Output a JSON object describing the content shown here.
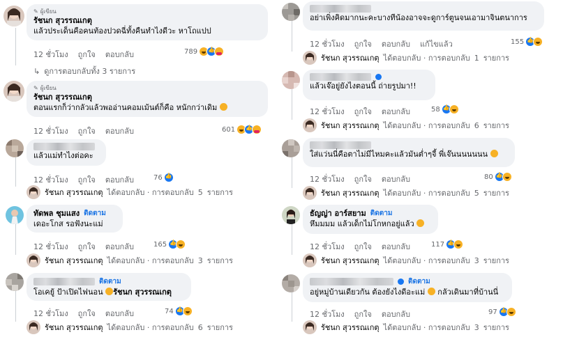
{
  "author_badge": "ผู้เขียน",
  "author_name": "รัชนก สุวรรณเกตุ",
  "follow_label": "ติดตาม",
  "actions": {
    "time": "12 ชั่วโมง",
    "like": "ถูกใจ",
    "reply": "ตอบกลับ",
    "edited": "แก้ไขแล้ว"
  },
  "replied_suffix": "ได้ตอบกลับ · การตอบกลับ",
  "items_suffix": "รายการ",
  "left": [
    {
      "text": "แล้วประเด็นคือคนท้องปวดฉี่ทั้งคืนทำไงดีวะ หาโถแปป",
      "count": "789",
      "more": "ดูการตอบกลับทั้ง 3 รายการ"
    },
    {
      "text": "ตอนแรกก็ว่ากลัวแล้วพออ่านคอมเม้นต์ก็คือ หนักกว่าเดิม",
      "count": "601"
    },
    {
      "text": "แล้วแม่ทำไงต่อคะ",
      "count": "76",
      "replies": "5"
    },
    {
      "name": "ทัดพล ชุมแสง",
      "text": "เดอะโกส รอฟังนะแม่",
      "count": "165",
      "replies": "3"
    },
    {
      "text": "โอเคยู้ ป้าเปิดไฟนอน",
      "mention": "รัชนก สุวรรณเกตุ",
      "count": "74",
      "replies": "6"
    }
  ],
  "right": [
    {
      "text": "อย่าเพิ่งคิดมากนะคะบางทีน้องอาจจะดูการ์ตูนจนเอามาจินตนาการ",
      "count": "155",
      "replies": "1"
    },
    {
      "text": "แล้วเจ๊อยู่ยังไงตอนนี้ ถ่ายรูปมา!!",
      "count": "58",
      "replies": "6"
    },
    {
      "text": "ใส่แว่นนี่คือตาไม่มีไหมคะแล้วมันต่ำๆจี้ พี่เจ๊นนนนนนน",
      "count": "80",
      "replies": "5"
    },
    {
      "name": "ธัญญ่า อาร์สยาม",
      "text": "หึมมมม แล้วเด็กไม่โกหกอยู่แล้ว",
      "count": "117",
      "replies": "3"
    },
    {
      "text": "อยู่หมู่บ้านเดียวกัน ต้องยังไงดีอะแม่",
      "text2": "กลัวเดินมาที่บ้านนี่",
      "count": "97",
      "replies": "3"
    }
  ]
}
